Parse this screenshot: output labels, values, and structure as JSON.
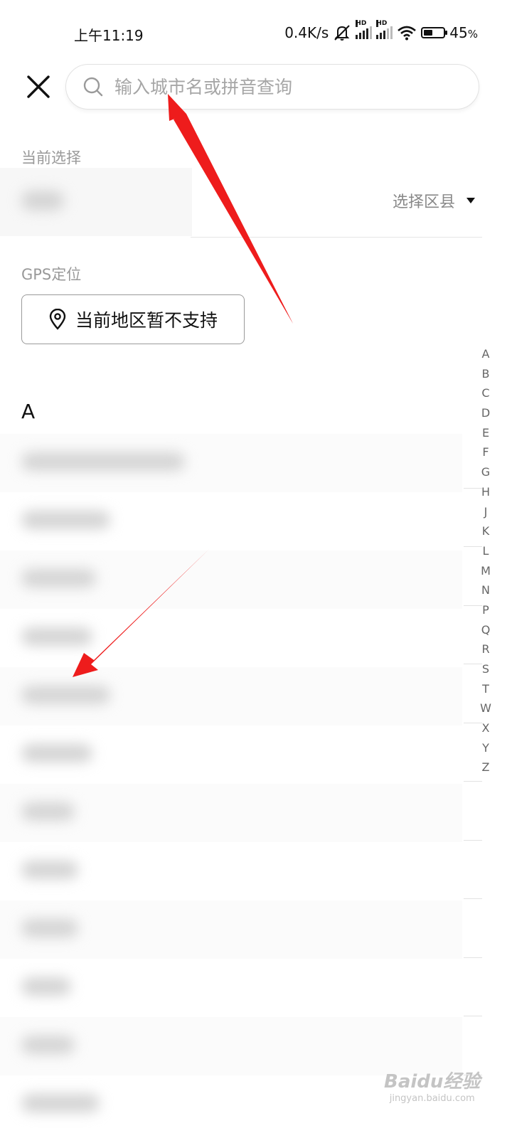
{
  "status_bar": {
    "time": "上午11:19",
    "net_speed": "0.4K/s",
    "hd_label": "HD",
    "battery": "45",
    "battery_unit": "%",
    "battery_level": 0.45
  },
  "search": {
    "placeholder": "输入城市名或拼音查询",
    "value": ""
  },
  "current": {
    "label": "当前选择",
    "district_label": "选择区县"
  },
  "gps": {
    "label": "GPS定位",
    "button_label": "当前地区暂不支持"
  },
  "list": {
    "section_letter": "A"
  },
  "index_letters": [
    "A",
    "B",
    "C",
    "D",
    "E",
    "F",
    "G",
    "H",
    "J",
    "K",
    "L",
    "M",
    "N",
    "P",
    "Q",
    "R",
    "S",
    "T",
    "W",
    "X",
    "Y",
    "Z"
  ],
  "watermark": {
    "main": "Baidu经验",
    "sub": "jingyan.baidu.com"
  },
  "colors": {
    "annotation_arrow": "#ee1c1c",
    "placeholder": "#a6a6a6",
    "muted_text": "#999999"
  },
  "icons": [
    "close-icon",
    "search-icon",
    "location-pin-icon",
    "caret-down-icon",
    "wifi-icon",
    "mute-icon",
    "battery-icon",
    "signal-icon"
  ]
}
